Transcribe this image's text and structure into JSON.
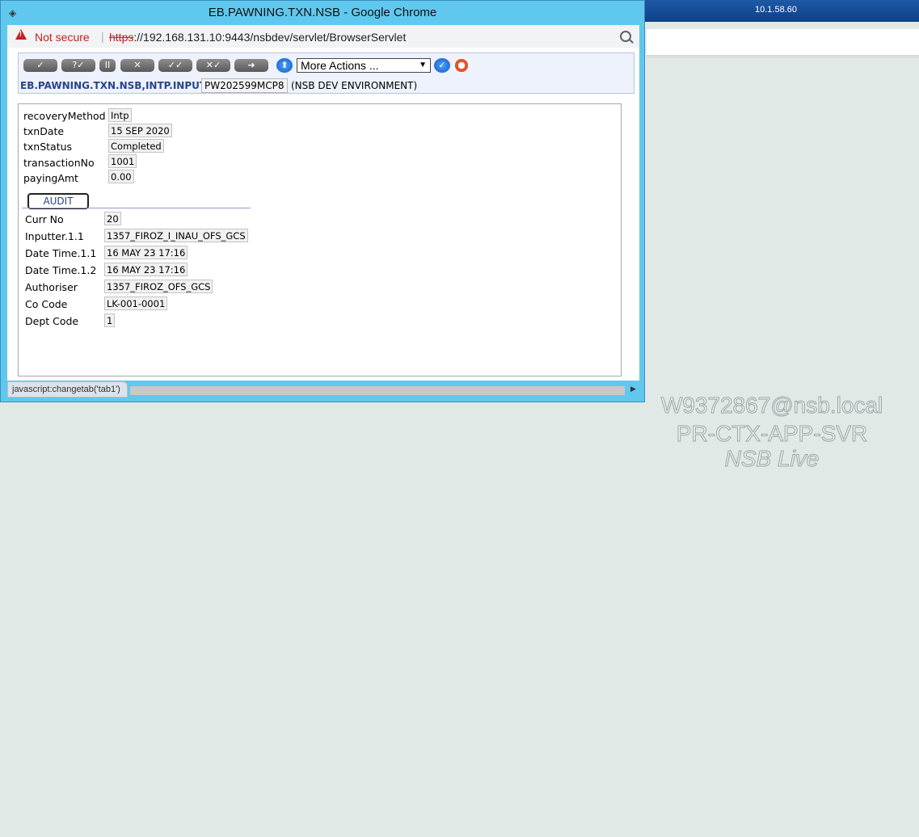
{
  "system_bar": {
    "ip": "10.1.58.60",
    "icons": [
      "dropdown-arrow-icon",
      "network-icon",
      "signal-bars-icon"
    ]
  },
  "window": {
    "title": "EB.PAWNING.TXN.NSB - Google Chrome",
    "address_bar": {
      "security_label": "Not secure",
      "url_scheme": "https",
      "url_rest": "://192.168.131.10:9443/nsbdev/servlet/BrowserServlet"
    }
  },
  "toolbar": {
    "buttons": [
      "✓",
      "?✓",
      "II",
      "✕",
      "✓✓",
      "✕✓",
      "➜"
    ],
    "more_actions": "More Actions ...",
    "app_name": "EB.PAWNING.TXN.NSB,INTP.INPUT",
    "record_id": "PW202599MCP8",
    "environment": "(NSB DEV ENVIRONMENT)"
  },
  "fields": [
    {
      "label": "recoveryMethod",
      "value": "Intp"
    },
    {
      "label": "txnDate",
      "value": "15 SEP 2020"
    },
    {
      "label": "txnStatus",
      "value": "Completed"
    },
    {
      "label": "transactionNo",
      "value": "1001"
    },
    {
      "label": "payingAmt",
      "value": "0.00"
    }
  ],
  "audit_tab": "AUDIT",
  "audit": [
    {
      "label": "Curr No",
      "value": "20"
    },
    {
      "label": "Inputter.1.1",
      "value": "1357_FIROZ_I_INAU_OFS_GCS"
    },
    {
      "label": "Date Time.1.1",
      "value": "16 MAY 23 17:16"
    },
    {
      "label": "Date Time.1.2",
      "value": "16 MAY 23 17:16"
    },
    {
      "label": "Authoriser",
      "value": "1357_FIROZ_OFS_GCS"
    },
    {
      "label": "Co Code",
      "value": "LK-001-0001"
    },
    {
      "label": "Dept Code",
      "value": "1"
    }
  ],
  "status_text": "javascript:changetab('tab1')",
  "watermark": {
    "line1": "W9372867@nsb.local",
    "line2": "PR-CTX-APP-SVR",
    "line3": "NSB Live"
  }
}
